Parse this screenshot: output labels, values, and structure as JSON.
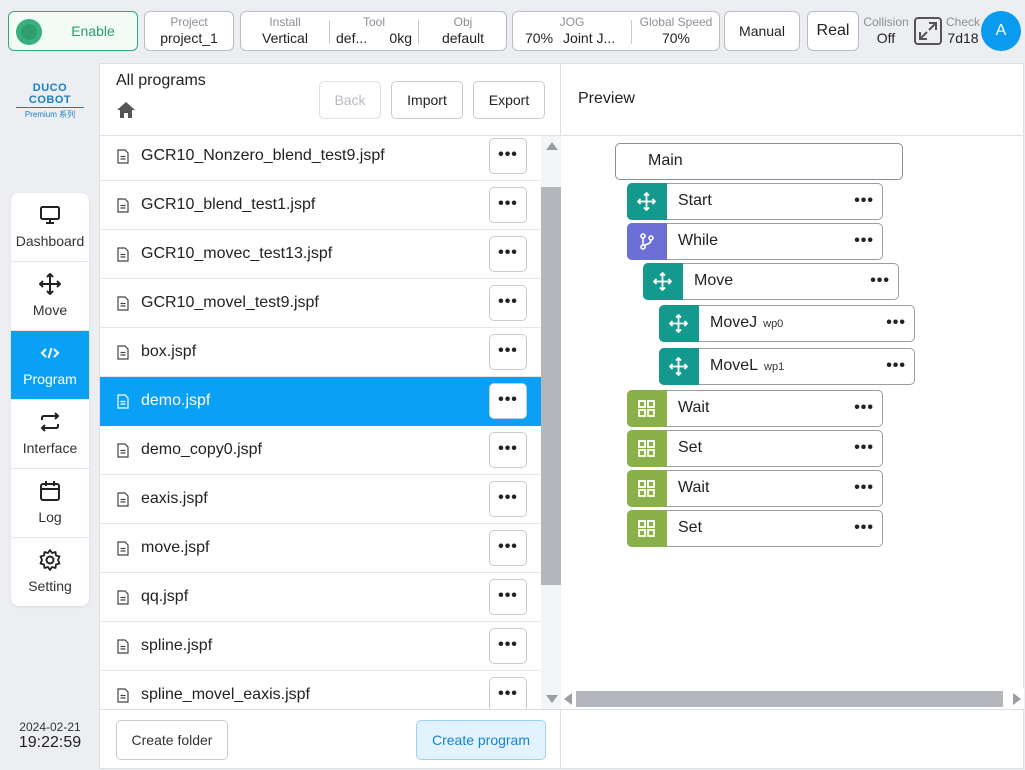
{
  "topbar": {
    "enable_label": "Enable",
    "project": {
      "title": "Project",
      "value": "project_1"
    },
    "install": {
      "title": "Install",
      "value": "Vertical"
    },
    "tool": {
      "title": "Tool",
      "name": "def...",
      "weight": "0kg"
    },
    "obj": {
      "title": "Obj",
      "value": "default"
    },
    "jog": {
      "title": "JOG",
      "speed": "70%",
      "mode": "Joint J..."
    },
    "global_speed": {
      "title": "Global Speed",
      "value": "70%"
    },
    "mode_button": "Manual",
    "real_button": "Real",
    "collision": {
      "title": "Collision",
      "value": "Off"
    },
    "check": {
      "title": "Check",
      "value": "7d18"
    },
    "avatar_letter": "A",
    "enable_color": "#2faa78"
  },
  "logo": {
    "brand": "DUCO COBOT",
    "series": "Premium 系列"
  },
  "nav": {
    "items": [
      {
        "label": "Dashboard",
        "icon": "monitor-icon"
      },
      {
        "label": "Move",
        "icon": "move-arrows-icon"
      },
      {
        "label": "Program",
        "icon": "code-icon"
      },
      {
        "label": "Interface",
        "icon": "swap-icon"
      },
      {
        "label": "Log",
        "icon": "calendar-icon"
      },
      {
        "label": "Setting",
        "icon": "gear-icon"
      }
    ],
    "active": "Program",
    "active_color": "#0aa0f5"
  },
  "datetime": {
    "date": "2024-02-21",
    "time": "19:22:59"
  },
  "programs": {
    "title": "All programs",
    "back_label": "Back",
    "import_label": "Import",
    "export_label": "Export",
    "files": [
      "GCR10_Nonzero_blend_test9.jspf",
      "GCR10_blend_test1.jspf",
      "GCR10_movec_test13.jspf",
      "GCR10_movel_test9.jspf",
      "box.jspf",
      "demo.jspf",
      "demo_copy0.jspf",
      "eaxis.jspf",
      "move.jspf",
      "qq.jspf",
      "spline.jspf",
      "spline_movel_eaxis.jspf"
    ],
    "selected": "demo.jspf",
    "more_label": "•••",
    "create_folder_label": "Create folder",
    "create_program_label": "Create program"
  },
  "preview": {
    "title": "Preview",
    "main_label": "Main",
    "nodes": [
      {
        "label": "Start",
        "sub": "",
        "icon": "move-arrows-icon",
        "color": "#13998e",
        "level": 1
      },
      {
        "label": "While",
        "sub": "",
        "icon": "branch-icon",
        "color": "#6b6fd6",
        "level": 1
      },
      {
        "label": "Move",
        "sub": "",
        "icon": "move-arrows-icon",
        "color": "#13998e",
        "level": 2
      },
      {
        "label": "MoveJ",
        "sub": "wp0",
        "icon": "move-arrows-icon",
        "color": "#13998e",
        "level": 3
      },
      {
        "label": "MoveL",
        "sub": "wp1",
        "icon": "move-arrows-icon",
        "color": "#13998e",
        "level": 3
      },
      {
        "label": "Wait",
        "sub": "",
        "icon": "grid-icon",
        "color": "#8ab04a",
        "level": 1
      },
      {
        "label": "Set",
        "sub": "",
        "icon": "grid-icon",
        "color": "#8ab04a",
        "level": 1
      },
      {
        "label": "Wait",
        "sub": "",
        "icon": "grid-icon",
        "color": "#8ab04a",
        "level": 1
      },
      {
        "label": "Set",
        "sub": "",
        "icon": "grid-icon",
        "color": "#8ab04a",
        "level": 1
      }
    ],
    "more_label": "•••"
  }
}
